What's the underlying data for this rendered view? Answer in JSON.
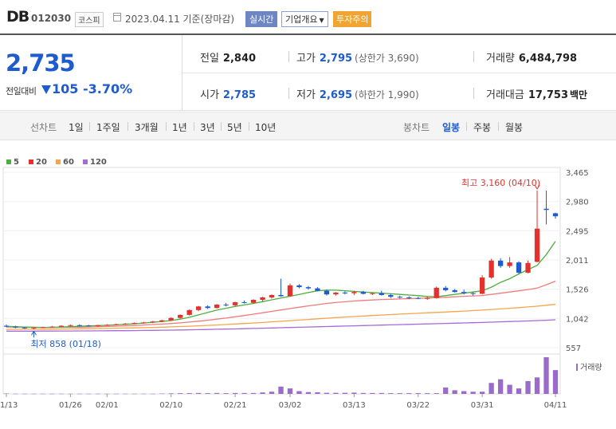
{
  "header": {
    "name": "DB",
    "code": "012030",
    "market": "코스피",
    "date_text": "2023.04.11 기준(장마감)",
    "realtime_label": "실시간",
    "company_menu": "기업개요",
    "warning": "투자주의"
  },
  "price": {
    "current": "2,735",
    "change_label": "전일대비",
    "change_value": "105",
    "change_pct": "-3.70%",
    "direction": "down"
  },
  "stats": {
    "prev_label": "전일",
    "prev_value": "2,840",
    "high_label": "고가",
    "high_value": "2,795",
    "upper_limit": "(상한가 3,690)",
    "volume_label": "거래량",
    "volume_value": "6,484,798",
    "open_label": "시가",
    "open_value": "2,785",
    "low_label": "저가",
    "low_value": "2,695",
    "lower_limit": "(하한가 1,990)",
    "amount_label": "거래대금",
    "amount_value": "17,753",
    "amount_unit": "백만"
  },
  "toolbar": {
    "line_chart_label": "선차트",
    "line_periods": [
      "1일",
      "1주일",
      "3개월",
      "1년",
      "3년",
      "5년",
      "10년"
    ],
    "candle_label": "봉차트",
    "candle_periods": [
      "일봉",
      "주봉",
      "월봉"
    ],
    "selected_candle": "일봉"
  },
  "colors": {
    "up": "#e3312d",
    "down": "#1f5bd0",
    "ma5": "#4caf3f",
    "ma20": "#f07b7b",
    "ma60": "#f5a54a",
    "ma120": "#a66bd3",
    "volume": "#9b6bc9"
  },
  "chart_data": {
    "type": "candlestick",
    "legend": [
      "5",
      "20",
      "60",
      "120"
    ],
    "y_ticks": [
      "3,465",
      "2,980",
      "2,495",
      "2,011",
      "1,526",
      "1,042",
      "557"
    ],
    "ylim": [
      557,
      3465
    ],
    "x_ticks": [
      "01/13",
      "01/26",
      "02/01",
      "02/10",
      "02/21",
      "03/02",
      "03/13",
      "03/22",
      "03/31",
      "04/11"
    ],
    "max_annotation": "최고 3,160 (04/10)",
    "min_annotation": "최저 858 (01/18)",
    "volume_label": "거래량",
    "candles": [
      {
        "d": "01/13",
        "o": 920,
        "h": 940,
        "l": 895,
        "c": 905
      },
      {
        "d": "01/16",
        "o": 905,
        "h": 920,
        "l": 880,
        "c": 890
      },
      {
        "d": "01/17",
        "o": 890,
        "h": 900,
        "l": 870,
        "c": 880
      },
      {
        "d": "01/18",
        "o": 880,
        "h": 895,
        "l": 858,
        "c": 890
      },
      {
        "d": "01/19",
        "o": 890,
        "h": 905,
        "l": 880,
        "c": 900
      },
      {
        "d": "01/20",
        "o": 900,
        "h": 915,
        "l": 890,
        "c": 905
      },
      {
        "d": "01/25",
        "o": 905,
        "h": 930,
        "l": 900,
        "c": 920
      },
      {
        "d": "01/26",
        "o": 920,
        "h": 940,
        "l": 910,
        "c": 930
      },
      {
        "d": "01/27",
        "o": 930,
        "h": 945,
        "l": 915,
        "c": 925
      },
      {
        "d": "01/30",
        "o": 925,
        "h": 935,
        "l": 910,
        "c": 915
      },
      {
        "d": "01/31",
        "o": 915,
        "h": 935,
        "l": 905,
        "c": 930
      },
      {
        "d": "02/01",
        "o": 930,
        "h": 945,
        "l": 920,
        "c": 935
      },
      {
        "d": "02/02",
        "o": 935,
        "h": 955,
        "l": 930,
        "c": 945
      },
      {
        "d": "02/03",
        "o": 945,
        "h": 965,
        "l": 935,
        "c": 955
      },
      {
        "d": "02/06",
        "o": 955,
        "h": 975,
        "l": 945,
        "c": 965
      },
      {
        "d": "02/07",
        "o": 965,
        "h": 985,
        "l": 955,
        "c": 975
      },
      {
        "d": "02/08",
        "o": 975,
        "h": 1000,
        "l": 965,
        "c": 990
      },
      {
        "d": "02/09",
        "o": 990,
        "h": 1020,
        "l": 980,
        "c": 1010
      },
      {
        "d": "02/10",
        "o": 1010,
        "h": 1060,
        "l": 1000,
        "c": 1050
      },
      {
        "d": "02/13",
        "o": 1050,
        "h": 1110,
        "l": 1040,
        "c": 1100
      },
      {
        "d": "02/14",
        "o": 1100,
        "h": 1190,
        "l": 1090,
        "c": 1180
      },
      {
        "d": "02/15",
        "o": 1180,
        "h": 1250,
        "l": 1160,
        "c": 1240
      },
      {
        "d": "02/16",
        "o": 1240,
        "h": 1260,
        "l": 1200,
        "c": 1215
      },
      {
        "d": "02/17",
        "o": 1215,
        "h": 1280,
        "l": 1205,
        "c": 1270
      },
      {
        "d": "02/20",
        "o": 1270,
        "h": 1300,
        "l": 1240,
        "c": 1260
      },
      {
        "d": "02/21",
        "o": 1260,
        "h": 1320,
        "l": 1240,
        "c": 1310
      },
      {
        "d": "02/22",
        "o": 1310,
        "h": 1340,
        "l": 1290,
        "c": 1300
      },
      {
        "d": "02/23",
        "o": 1300,
        "h": 1360,
        "l": 1290,
        "c": 1350
      },
      {
        "d": "02/24",
        "o": 1350,
        "h": 1400,
        "l": 1320,
        "c": 1390
      },
      {
        "d": "02/27",
        "o": 1390,
        "h": 1440,
        "l": 1370,
        "c": 1430
      },
      {
        "d": "02/28",
        "o": 1430,
        "h": 1700,
        "l": 1400,
        "c": 1410
      },
      {
        "d": "03/02",
        "o": 1410,
        "h": 1620,
        "l": 1400,
        "c": 1590
      },
      {
        "d": "03/03",
        "o": 1590,
        "h": 1610,
        "l": 1540,
        "c": 1560
      },
      {
        "d": "03/06",
        "o": 1560,
        "h": 1580,
        "l": 1520,
        "c": 1540
      },
      {
        "d": "03/07",
        "o": 1540,
        "h": 1560,
        "l": 1490,
        "c": 1500
      },
      {
        "d": "03/08",
        "o": 1500,
        "h": 1520,
        "l": 1420,
        "c": 1440
      },
      {
        "d": "03/09",
        "o": 1440,
        "h": 1480,
        "l": 1420,
        "c": 1470
      },
      {
        "d": "03/10",
        "o": 1470,
        "h": 1490,
        "l": 1440,
        "c": 1460
      },
      {
        "d": "03/13",
        "o": 1460,
        "h": 1500,
        "l": 1430,
        "c": 1480
      },
      {
        "d": "03/14",
        "o": 1480,
        "h": 1500,
        "l": 1440,
        "c": 1450
      },
      {
        "d": "03/15",
        "o": 1450,
        "h": 1470,
        "l": 1430,
        "c": 1460
      },
      {
        "d": "03/16",
        "o": 1460,
        "h": 1500,
        "l": 1420,
        "c": 1430
      },
      {
        "d": "03/17",
        "o": 1430,
        "h": 1450,
        "l": 1380,
        "c": 1400
      },
      {
        "d": "03/20",
        "o": 1400,
        "h": 1420,
        "l": 1370,
        "c": 1390
      },
      {
        "d": "03/21",
        "o": 1390,
        "h": 1410,
        "l": 1360,
        "c": 1380
      },
      {
        "d": "03/22",
        "o": 1380,
        "h": 1400,
        "l": 1360,
        "c": 1370
      },
      {
        "d": "03/23",
        "o": 1370,
        "h": 1400,
        "l": 1350,
        "c": 1380
      },
      {
        "d": "03/24",
        "o": 1380,
        "h": 1570,
        "l": 1370,
        "c": 1550
      },
      {
        "d": "03/27",
        "o": 1550,
        "h": 1580,
        "l": 1490,
        "c": 1510
      },
      {
        "d": "03/28",
        "o": 1510,
        "h": 1530,
        "l": 1470,
        "c": 1480
      },
      {
        "d": "03/29",
        "o": 1480,
        "h": 1520,
        "l": 1440,
        "c": 1460
      },
      {
        "d": "03/30",
        "o": 1460,
        "h": 1480,
        "l": 1420,
        "c": 1450
      },
      {
        "d": "03/31",
        "o": 1450,
        "h": 1760,
        "l": 1440,
        "c": 1720
      },
      {
        "d": "04/03",
        "o": 1720,
        "h": 2030,
        "l": 1700,
        "c": 2000
      },
      {
        "d": "04/04",
        "o": 2000,
        "h": 2040,
        "l": 1880,
        "c": 1910
      },
      {
        "d": "04/05",
        "o": 1910,
        "h": 2060,
        "l": 1880,
        "c": 1970
      },
      {
        "d": "04/06",
        "o": 1970,
        "h": 1990,
        "l": 1780,
        "c": 1800
      },
      {
        "d": "04/07",
        "o": 1800,
        "h": 2000,
        "l": 1790,
        "c": 1960
      },
      {
        "d": "04/10",
        "o": 1980,
        "h": 3160,
        "l": 1970,
        "c": 2530
      },
      {
        "d": "04/10b",
        "o": 2860,
        "h": 3160,
        "l": 2600,
        "c": 2840
      },
      {
        "d": "04/11",
        "o": 2785,
        "h": 2795,
        "l": 2695,
        "c": 2735
      }
    ],
    "volumes": [
      2,
      1,
      1,
      1,
      1,
      1,
      1,
      1,
      1,
      1,
      1,
      1,
      1,
      1,
      1,
      1,
      1,
      2,
      3,
      4,
      4,
      5,
      4,
      5,
      4,
      5,
      5,
      5,
      8,
      12,
      40,
      30,
      15,
      10,
      9,
      6,
      6,
      6,
      7,
      5,
      5,
      5,
      4,
      4,
      4,
      4,
      4,
      4,
      35,
      20,
      15,
      12,
      12,
      60,
      80,
      50,
      30,
      70,
      90,
      200,
      130
    ],
    "ma5": [
      910,
      905,
      900,
      896,
      893,
      895,
      900,
      905,
      912,
      918,
      922,
      928,
      935,
      944,
      954,
      965,
      977,
      991,
      1006,
      1030,
      1060,
      1100,
      1140,
      1180,
      1210,
      1240,
      1265,
      1290,
      1320,
      1350,
      1380,
      1410,
      1440,
      1470,
      1500,
      1510,
      1510,
      1500,
      1490,
      1480,
      1470,
      1460,
      1450,
      1440,
      1430,
      1420,
      1405,
      1400,
      1420,
      1440,
      1460,
      1480,
      1500,
      1560,
      1640,
      1700,
      1780,
      1850,
      1920,
      2100,
      2320
    ],
    "ma20": [
      900,
      898,
      896,
      894,
      893,
      893,
      894,
      895,
      897,
      900,
      904,
      908,
      913,
      919,
      925,
      932,
      940,
      948,
      957,
      968,
      981,
      996,
      1012,
      1030,
      1048,
      1068,
      1090,
      1112,
      1135,
      1158,
      1182,
      1205,
      1228,
      1250,
      1270,
      1290,
      1305,
      1318,
      1330,
      1340,
      1348,
      1355,
      1360,
      1365,
      1370,
      1375,
      1380,
      1385,
      1392,
      1400,
      1408,
      1415,
      1422,
      1440,
      1460,
      1480,
      1500,
      1520,
      1545,
      1600,
      1660
    ],
    "ma60": [
      860,
      861,
      862,
      863,
      864,
      865,
      866,
      868,
      870,
      872,
      874,
      876,
      879,
      882,
      885,
      889,
      893,
      897,
      902,
      907,
      913,
      919,
      926,
      933,
      941,
      949,
      957,
      966,
      975,
      985,
      995,
      1005,
      1015,
      1025,
      1035,
      1045,
      1055,
      1064,
      1073,
      1082,
      1090,
      1098,
      1106,
      1113,
      1120,
      1127,
      1134,
      1141,
      1148,
      1156,
      1164,
      1172,
      1180,
      1190,
      1200,
      1210,
      1220,
      1232,
      1245,
      1260,
      1275
    ],
    "ma120": [
      830,
      830,
      831,
      831,
      832,
      832,
      833,
      833,
      834,
      835,
      836,
      837,
      838,
      839,
      840,
      842,
      844,
      846,
      848,
      850,
      853,
      856,
      859,
      862,
      865,
      868,
      871,
      875,
      879,
      883,
      887,
      891,
      895,
      899,
      903,
      907,
      911,
      915,
      919,
      923,
      927,
      931,
      935,
      939,
      943,
      947,
      951,
      955,
      959,
      963,
      967,
      971,
      975,
      980,
      985,
      990,
      995,
      1000,
      1006,
      1012,
      1020
    ]
  }
}
